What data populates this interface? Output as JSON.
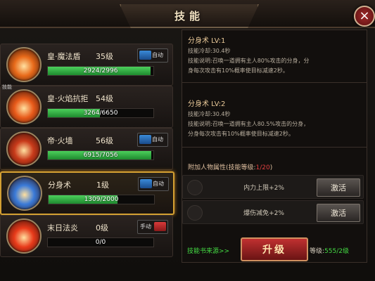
{
  "window": {
    "title": "技能",
    "close_label": "×"
  },
  "skills": [
    {
      "name": "皇·魔法盾",
      "level": "35级",
      "toggle": "自动",
      "toggle_on": true,
      "progress": "2924/2996",
      "fill": 0.976,
      "icon_color": "#e86a1a"
    },
    {
      "name": "皇·火焰抗拒",
      "level": "54级",
      "toggle": "",
      "toggle_on": null,
      "progress": "3264/6650",
      "fill": 0.491,
      "icon_color": "#e85a1a",
      "badge": "技能"
    },
    {
      "name": "帝·火墙",
      "level": "56级",
      "toggle": "自动",
      "toggle_on": true,
      "progress": "6915/7056",
      "fill": 0.98,
      "icon_color": "#c83a1a"
    },
    {
      "name": "分身术",
      "level": "1级",
      "toggle": "自动",
      "toggle_on": true,
      "progress": "1309/2000",
      "fill": 0.6545,
      "icon_color": "#3a7ad8"
    },
    {
      "name": "末日法炎",
      "level": "0级",
      "toggle": "手动",
      "toggle_on": false,
      "progress": "0/0",
      "fill": 0,
      "icon_color": "#e83a1a"
    }
  ],
  "detail": {
    "current": {
      "title": "分身术  LV:1",
      "cooldown": "技能冷却:30.4秒",
      "desc1": "技能说明:召唤一道拥有主人80%攻击的分身，分",
      "desc2": "身每次攻击有10%概率使目标减速2秒。"
    },
    "next": {
      "title": "分身术  LV:2",
      "cooldown": "技能冷却:30.4秒",
      "desc1": "技能说明:召唤一道拥有主人80.5%攻击的分身，",
      "desc2": "分身每次攻击有10%概率使目标减速2秒。"
    },
    "attr_title": "附加人物属性(技能等级:",
    "attr_title_count": "1/20",
    "attr_title_end": ")",
    "attrs": [
      {
        "text": "内力上限+2%",
        "button": "激活"
      },
      {
        "text": "爆伤减免+2%",
        "button": "激活"
      }
    ]
  },
  "footer": {
    "source_link": "技能书来源>>",
    "upgrade_label": "升级",
    "level_prefix": "等级:",
    "level_value": "555/2级"
  },
  "colors": {
    "accent_gold": "#d4a032",
    "progress_green": "#2eb040",
    "upgrade_red": "#c03030"
  }
}
